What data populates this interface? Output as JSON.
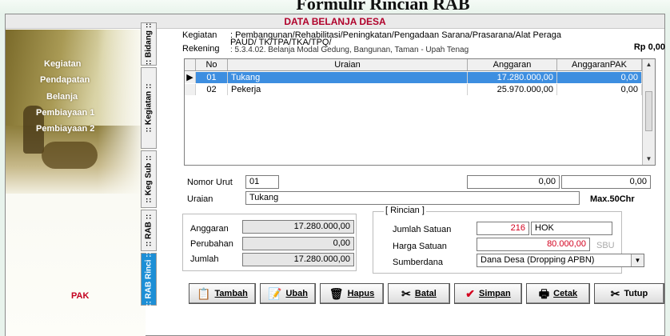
{
  "slide_title": "Formulir Rincian RAB",
  "window": {
    "title": "DATA BELANJA DESA"
  },
  "left_menu": [
    "Kegiatan",
    "Pendapatan",
    "Belanja",
    "Pembiayaan 1",
    "Pembiayaan 2"
  ],
  "pak": "PAK",
  "vtabs": [
    ":: Bidang ::",
    ":: Kegiatan ::",
    ":: Keg Sub ::",
    ":: RAB ::",
    ":: RAB Rinci ::"
  ],
  "info": {
    "kegiatan_label": "Kegiatan",
    "kegiatan_value": ": Pembangunan/Rehabilitasi/Peningkatan/Pengadaan Sarana/Prasarana/Alat Peraga",
    "kegiatan_value2": "PAUD/ TK/TPA/TKA/TPQ/",
    "rekening_label": "Rekening",
    "rekening_value": ": 5.3.4.02. Belanja Modal Gedung, Bangunan, Taman - Upah Tenag",
    "total": "Rp 0,00"
  },
  "grid": {
    "headers": [
      "No",
      "Uraian",
      "Anggaran",
      "AnggaranPAK"
    ],
    "rows": [
      {
        "no": "01",
        "uraian": "Tukang",
        "anggaran": "17.280.000,00",
        "anggaran_pak": "0,00"
      },
      {
        "no": "02",
        "uraian": "Pekerja",
        "anggaran": "25.970.000,00",
        "anggaran_pak": "0,00"
      }
    ]
  },
  "form": {
    "nomor_urut_label": "Nomor Urut",
    "nomor_urut": "01",
    "box1": "0,00",
    "box2": "0,00",
    "uraian_label": "Uraian",
    "uraian": "Tukang",
    "max": "Max.50Chr",
    "anggaran_label": "Anggaran",
    "anggaran": "17.280.000,00",
    "perubahan_label": "Perubahan",
    "perubahan": "0,00",
    "jumlah_label": "Jumlah",
    "jumlah": "17.280.000,00",
    "rincian_legend": "[ Rincian ]",
    "jumlah_satuan_label": "Jumlah Satuan",
    "jumlah_satuan": "216",
    "satuan": "HOK",
    "harga_satuan_label": "Harga Satuan",
    "harga_satuan": "80.000,00",
    "sbu": "SBU",
    "sumberdana_label": "Sumberdana",
    "sumberdana": "Dana Desa (Dropping APBN)"
  },
  "buttons": [
    {
      "label": "Tambah",
      "icon": "add-icon"
    },
    {
      "label": "Ubah",
      "icon": "edit-icon"
    },
    {
      "label": "Hapus",
      "icon": "delete-icon"
    },
    {
      "label": "Batal",
      "icon": "cancel-icon"
    },
    {
      "label": "Simpan",
      "icon": "checkmark-icon"
    },
    {
      "label": "Cetak",
      "icon": "printer-icon"
    },
    {
      "label": "Tutup",
      "icon": "close-icon"
    }
  ]
}
